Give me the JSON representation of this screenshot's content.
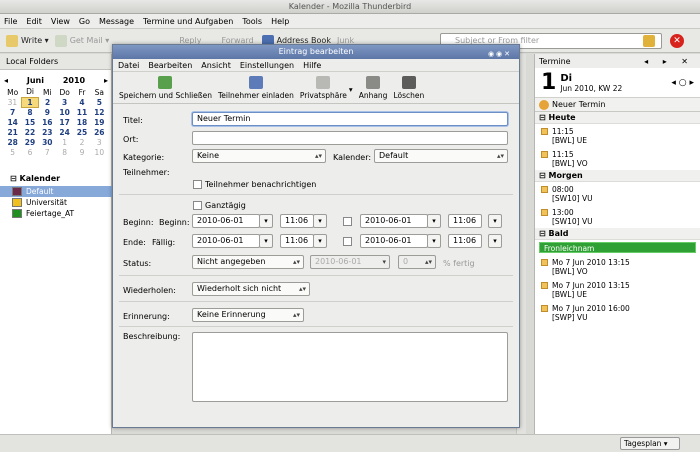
{
  "window": {
    "title": "Kalender - Mozilla Thunderbird"
  },
  "menubar": {
    "items": [
      "File",
      "Edit",
      "View",
      "Go",
      "Message",
      "Termine und Aufgaben",
      "Tools",
      "Help"
    ]
  },
  "toolbar": {
    "write": "Write",
    "getmail": "Get Mail",
    "reply": "Reply",
    "forward": "Forward",
    "addressbook": "Address Book",
    "junk": "Junk"
  },
  "search": {
    "placeholder": "Subject or From filter"
  },
  "leftpane": {
    "header": "Local Folders",
    "minical": {
      "month": "Juni",
      "year": "2010",
      "weekdays": [
        "Mo",
        "Di",
        "Mi",
        "Do",
        "Fr",
        "Sa"
      ],
      "weeks": [
        [
          "31",
          "1",
          "2",
          "3",
          "4",
          "5"
        ],
        [
          "7",
          "8",
          "9",
          "10",
          "11",
          "12"
        ],
        [
          "14",
          "15",
          "16",
          "17",
          "18",
          "19"
        ],
        [
          "21",
          "22",
          "23",
          "24",
          "25",
          "26"
        ],
        [
          "28",
          "29",
          "30",
          "1",
          "2",
          "3"
        ],
        [
          "5",
          "6",
          "7",
          "8",
          "9",
          "10"
        ]
      ]
    },
    "kalender": {
      "header": "Kalender",
      "items": [
        {
          "name": "Default",
          "color": "#6b2a4a"
        },
        {
          "name": "Universität",
          "color": "#f0c020"
        },
        {
          "name": "Feiertage_AT",
          "color": "#209020"
        }
      ]
    }
  },
  "rightpane": {
    "header": "Termine",
    "day_number": "1",
    "day_name": "Di",
    "day_sub": "Jun 2010, KW 22",
    "new_event": "Neuer Termin",
    "sections": [
      {
        "title": "Heute",
        "events": [
          [
            "11:15",
            "[BWL] UE"
          ],
          [
            "11:15",
            "[BWL] VO"
          ]
        ]
      },
      {
        "title": "Morgen",
        "events": [
          [
            "08:00",
            "[SW10] VU"
          ],
          [
            "13:00",
            "[SW10] VU"
          ]
        ]
      },
      {
        "title": "Bald",
        "holiday": "Fronleichnam",
        "events": [
          [
            "Mo 7 Jun 2010 13:15",
            "[BWL] VO"
          ],
          [
            "Mo 7 Jun 2010 13:15",
            "[BWL] UE"
          ],
          [
            "Mo 7 Jun 2010 16:00",
            "[SWP] VU"
          ]
        ]
      }
    ]
  },
  "statusbar": {
    "view": "Tagesplan"
  },
  "dialog": {
    "title": "Eintrag bearbeiten",
    "menu": [
      "Datei",
      "Bearbeiten",
      "Ansicht",
      "Einstellungen",
      "Hilfe"
    ],
    "tools": {
      "save": "Speichern und Schließen",
      "invite": "Teilnehmer einladen",
      "privacy": "Privatsphäre",
      "attach": "Anhang",
      "delete": "Löschen"
    },
    "labels": {
      "title": "Titel:",
      "location": "Ort:",
      "category": "Kategorie:",
      "calendar": "Kalender:",
      "attendees": "Teilnehmer:",
      "notify": "Teilnehmer benachrichtigen",
      "allday": "Ganztägig",
      "begin1": "Beginn:",
      "begin2": "Beginn:",
      "end1": "Ende:",
      "due": "Fällig:",
      "status": "Status:",
      "percent": "% fertig",
      "repeat": "Wiederholen:",
      "reminder": "Erinnerung:",
      "description": "Beschreibung:"
    },
    "values": {
      "title": "Neuer Termin",
      "location": "",
      "category": "Keine",
      "calendar": "Default",
      "begin_date": "2010-06-01",
      "begin_time": "11:06",
      "end_date": "2010-06-01",
      "end_time": "11:06",
      "begin2_date": "2010-06-01",
      "begin2_time": "11:06",
      "end2_date": "2010-06-01",
      "end2_time": "11:06",
      "status": "Nicht angegeben",
      "status_date": "2010-06-01",
      "percent": "0",
      "repeat": "Wiederholt sich nicht",
      "reminder": "Keine Erinnerung"
    }
  }
}
